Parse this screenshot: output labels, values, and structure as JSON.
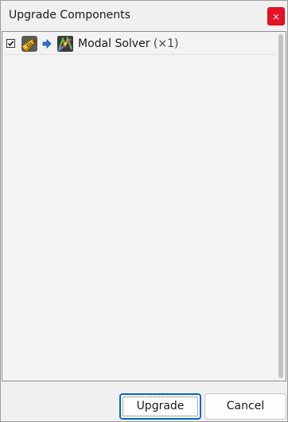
{
  "window": {
    "title": "Upgrade Components",
    "close_glyph": "×"
  },
  "components": [
    {
      "checked": true,
      "from_icon": "old-component-icon",
      "arrow_icon": "arrow-right-icon",
      "to_icon": "modal-solver-icon",
      "name": "Modal Solver",
      "count": "(×1)"
    }
  ],
  "buttons": {
    "upgrade": "Upgrade",
    "cancel": "Cancel"
  },
  "colors": {
    "close_button": "#e81123",
    "default_button_border": "#0067c0",
    "arrow": "#2f6fd6"
  }
}
